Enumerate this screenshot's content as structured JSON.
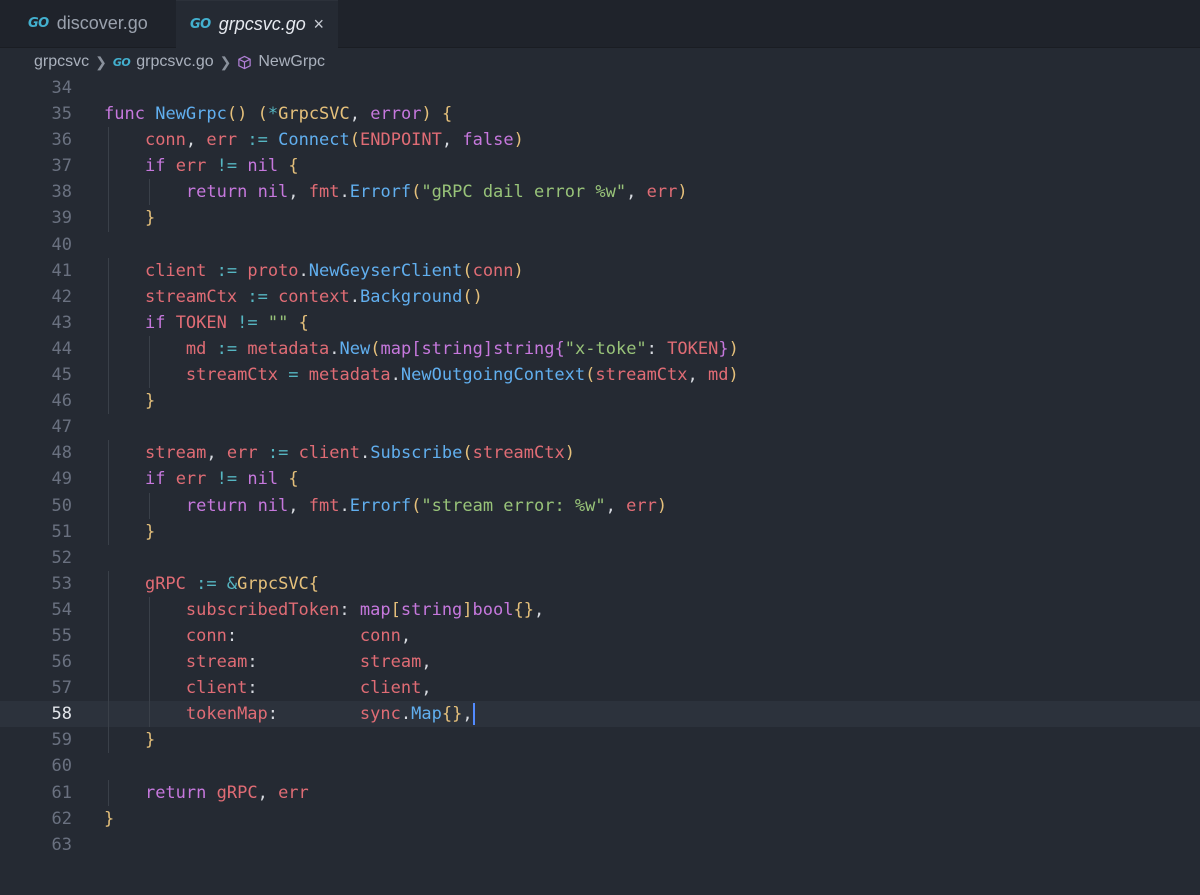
{
  "tabs": [
    {
      "icon": "GO",
      "label": "discover.go"
    },
    {
      "icon": "GO",
      "label": "grpcsvc.go",
      "close": "×"
    }
  ],
  "breadcrumb": {
    "folder": "grpcsvc",
    "file_icon": "GO",
    "file": "grpcsvc.go",
    "symbol": "NewGrpc"
  },
  "code": {
    "language": "go",
    "current_line": 58,
    "lines": [
      {
        "n": "34",
        "text": ""
      },
      {
        "n": "35",
        "text": "func NewGrpc() (*GrpcSVC, error) {"
      },
      {
        "n": "36",
        "text": "    conn, err := Connect(ENDPOINT, false)"
      },
      {
        "n": "37",
        "text": "    if err != nil {"
      },
      {
        "n": "38",
        "text": "        return nil, fmt.Errorf(\"gRPC dail error %w\", err)"
      },
      {
        "n": "39",
        "text": "    }"
      },
      {
        "n": "40",
        "text": ""
      },
      {
        "n": "41",
        "text": "    client := proto.NewGeyserClient(conn)"
      },
      {
        "n": "42",
        "text": "    streamCtx := context.Background()"
      },
      {
        "n": "43",
        "text": "    if TOKEN != \"\" {"
      },
      {
        "n": "44",
        "text": "        md := metadata.New(map[string]string{\"x-toke\": TOKEN})"
      },
      {
        "n": "45",
        "text": "        streamCtx = metadata.NewOutgoingContext(streamCtx, md)"
      },
      {
        "n": "46",
        "text": "    }"
      },
      {
        "n": "47",
        "text": ""
      },
      {
        "n": "48",
        "text": "    stream, err := client.Subscribe(streamCtx)"
      },
      {
        "n": "49",
        "text": "    if err != nil {"
      },
      {
        "n": "50",
        "text": "        return nil, fmt.Errorf(\"stream error: %w\", err)"
      },
      {
        "n": "51",
        "text": "    }"
      },
      {
        "n": "52",
        "text": ""
      },
      {
        "n": "53",
        "text": "    gRPC := &GrpcSVC{"
      },
      {
        "n": "54",
        "text": "        subscribedToken: map[string]bool{},"
      },
      {
        "n": "55",
        "text": "        conn:            conn,"
      },
      {
        "n": "56",
        "text": "        stream:          stream,"
      },
      {
        "n": "57",
        "text": "        client:          client,"
      },
      {
        "n": "58",
        "text": "        tokenMap:        sync.Map{},"
      },
      {
        "n": "59",
        "text": "    }"
      },
      {
        "n": "60",
        "text": ""
      },
      {
        "n": "61",
        "text": "    return gRPC, err"
      },
      {
        "n": "62",
        "text": "}"
      },
      {
        "n": "63",
        "text": ""
      }
    ]
  },
  "colors": {
    "background": "#252a33",
    "keyword": "#c678dd",
    "function": "#61afef",
    "type": "#e5c07b",
    "variable": "#e06c75",
    "string": "#98c379",
    "cursor": "#528bff"
  }
}
